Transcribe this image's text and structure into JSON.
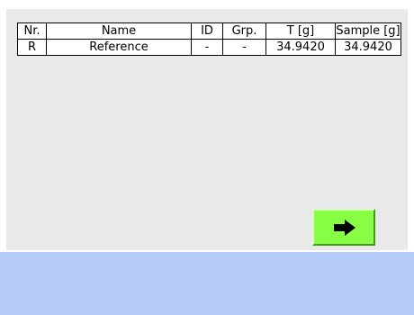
{
  "table": {
    "headers": {
      "nr": "Nr.",
      "name": "Name",
      "id": "ID",
      "grp": "Grp.",
      "t": "T [g]",
      "sample": "Sample [g]"
    },
    "rows": [
      {
        "nr": "R",
        "name": "Reference",
        "id": "-",
        "grp": "-",
        "t": "34.9420",
        "sample": "34.9420"
      }
    ]
  },
  "next_button": {
    "icon": "arrow-right-icon",
    "color": "#88ff44"
  },
  "colors": {
    "panel_background": "#e9e9e9",
    "footer_bar": "#b6cdfc"
  }
}
